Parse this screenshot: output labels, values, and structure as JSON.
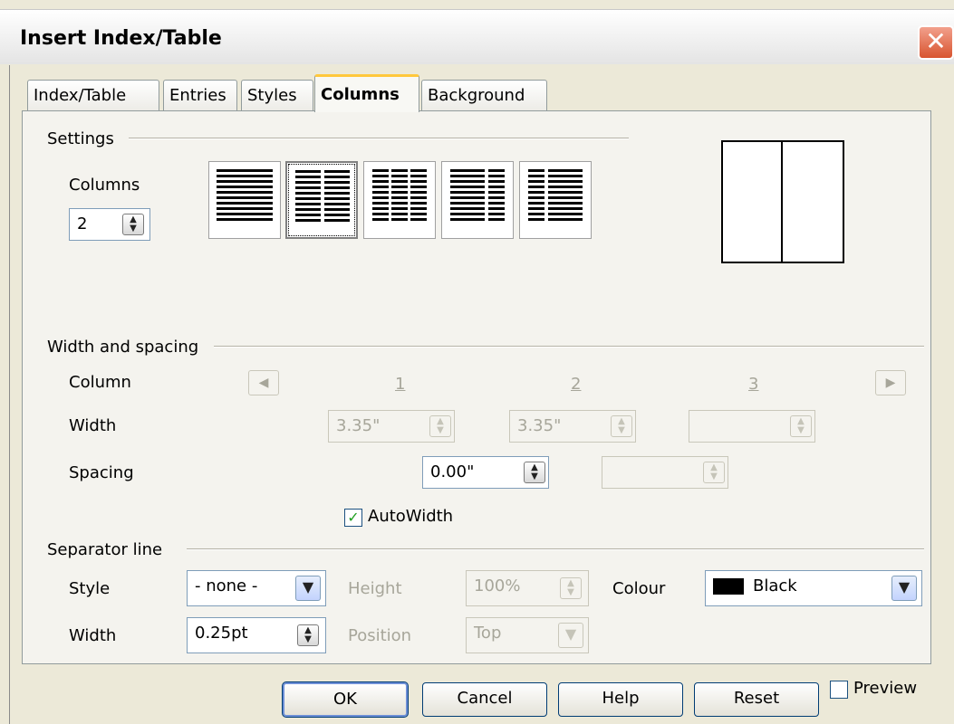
{
  "window": {
    "title": "Insert Index/Table",
    "close_icon": "close-icon"
  },
  "tabs": [
    {
      "label": "Index/Table"
    },
    {
      "label": "Entries"
    },
    {
      "label": "Styles"
    },
    {
      "label": "Columns",
      "active": true
    },
    {
      "label": "Background"
    }
  ],
  "settings": {
    "group_label": "Settings",
    "columns_label": "Columns",
    "columns_value": "2",
    "presets": [
      "1 column",
      "2 columns",
      "3 columns",
      "2 columns left-wide",
      "2 columns right-wide"
    ]
  },
  "width_spacing": {
    "group_label": "Width and spacing",
    "column_label": "Column",
    "column_numbers": [
      "1",
      "2",
      "3"
    ],
    "width_label": "Width",
    "width_values": [
      "3.35\"",
      "3.35\"",
      ""
    ],
    "spacing_label": "Spacing",
    "spacing_values": [
      "0.00\"",
      ""
    ],
    "autowidth_label": "AutoWidth",
    "autowidth_checked": true
  },
  "separator": {
    "group_label": "Separator line",
    "style_label": "Style",
    "style_value": "- none -",
    "height_label": "Height",
    "height_value": "100%",
    "colour_label": "Colour",
    "colour_value": "Black",
    "colour_swatch": "#000000",
    "width_label": "Width",
    "width_value": "0.25pt",
    "position_label": "Position",
    "position_value": "Top"
  },
  "buttons": {
    "ok": "OK",
    "cancel": "Cancel",
    "help": "Help",
    "reset": "Reset",
    "preview_label": "Preview"
  }
}
